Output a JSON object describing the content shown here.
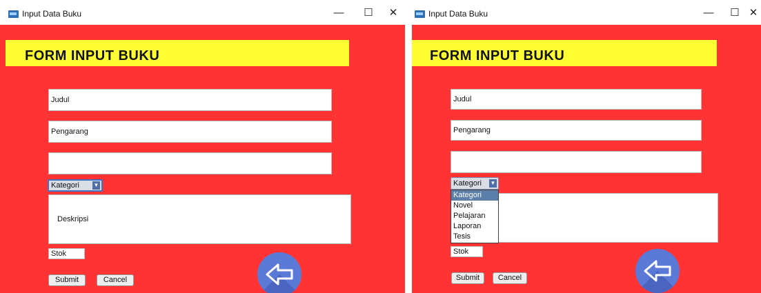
{
  "windows": [
    {
      "title": "Input Data Buku",
      "form_title": "FORM INPUT BUKU",
      "fields": {
        "judul": "Judul",
        "pengarang": "Pengarang",
        "empty_value": ""
      },
      "kategori": {
        "selected": "Kategori",
        "dropdown_open": false
      },
      "deskripsi": "Deskripsi",
      "stok": "Stok",
      "submit_label": "Submit",
      "cancel_label": "Cancel"
    },
    {
      "title": "Input Data Buku",
      "form_title": "FORM INPUT BUKU",
      "fields": {
        "judul": "Judul",
        "pengarang": "Pengarang",
        "empty_value": ""
      },
      "kategori": {
        "selected": "Kategori",
        "dropdown_open": true,
        "options": [
          "Kategori",
          "Novel",
          "Pelajaran",
          "Laporan",
          "Tesis"
        ]
      },
      "deskripsi": "",
      "stok": "Stok",
      "submit_label": "Submit",
      "cancel_label": "Cancel"
    }
  ],
  "window_controls": {
    "minimize": "—",
    "maximize": "☐",
    "close": "✕"
  },
  "colors": {
    "form_background": "#ff3333",
    "banner": "#ffff33",
    "back_button": "#5b7ad8",
    "dropdown_selected": "#5b7fa8"
  },
  "icons": {
    "back": "arrow-left-icon",
    "app": "java-app-icon",
    "combo_arrow": "caret-down-icon"
  }
}
